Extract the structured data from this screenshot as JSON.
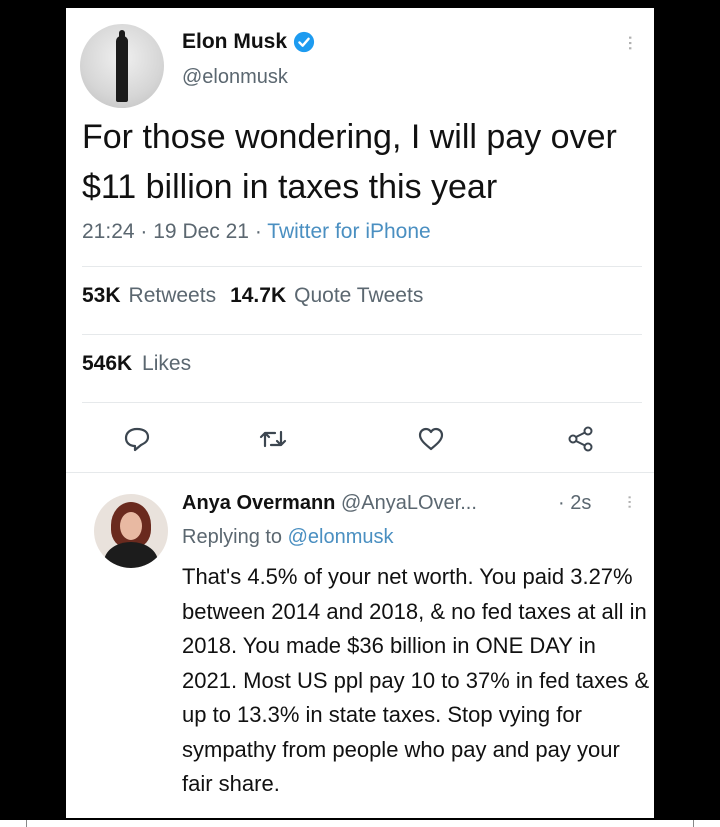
{
  "tweet": {
    "author_name": "Elon Musk",
    "author_handle": "@elonmusk",
    "text": "For those wondering, I will pay over $11 billion in taxes this year",
    "time": "21:24",
    "date": "19 Dec 21",
    "source": "Twitter for iPhone",
    "sep": "·",
    "more_glyph": "···"
  },
  "stats": {
    "retweets_count": "53K",
    "retweets_label": "Retweets",
    "quotes_count": "14.7K",
    "quotes_label": "Quote Tweets",
    "likes_count": "546K",
    "likes_label": "Likes"
  },
  "actions": [
    {
      "icon": "reply-icon"
    },
    {
      "icon": "retweet-icon"
    },
    {
      "icon": "heart-icon"
    },
    {
      "icon": "share-icon"
    }
  ],
  "reply": {
    "author_name": "Anya Overmann",
    "author_handle": "@AnyaLOver...",
    "time": "· 2s",
    "replying_prefix": "Replying to",
    "replying_to": "@elonmusk",
    "text": "That's 4.5% of your net worth. You paid 3.27% between 2014 and 2018, & no fed taxes at all in 2018. You made $36 billion in ONE DAY in 2021. Most US ppl pay 10 to 37% in fed taxes & up to 13.3% in state taxes. Stop vying for sympathy from people who pay and pay your fair share."
  },
  "colors": {
    "verified": "#1d9bf0",
    "link": "#4a8fc1",
    "secondary": "#5b6770"
  }
}
